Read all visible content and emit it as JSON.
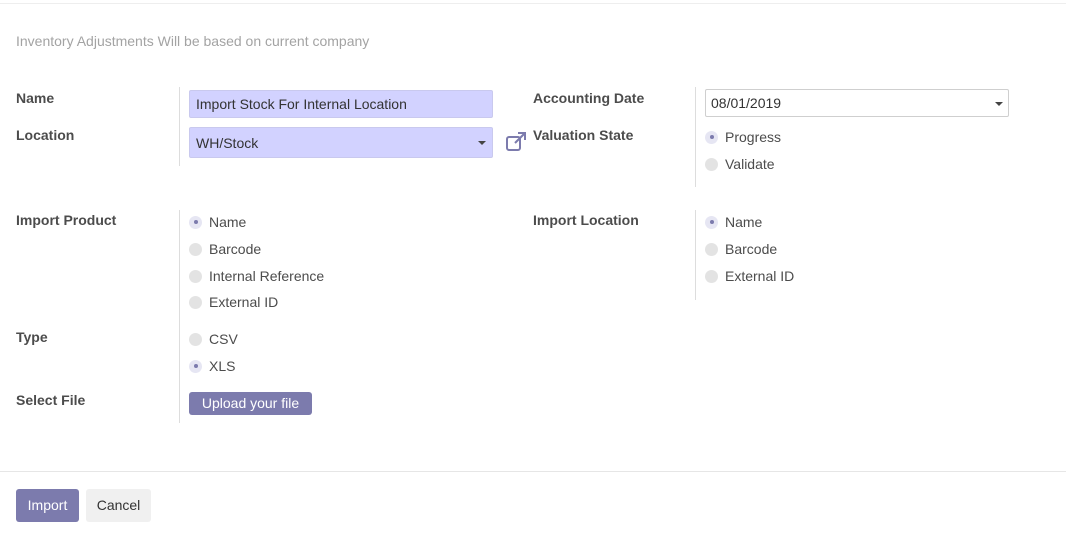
{
  "note": "Inventory Adjustments Will be based on current company",
  "fields": {
    "name": {
      "label": "Name",
      "value": "Import Stock For Internal Location"
    },
    "location": {
      "label": "Location",
      "value": "WH/Stock"
    },
    "accounting_date": {
      "label": "Accounting Date",
      "value": "08/01/2019"
    },
    "valuation_state": {
      "label": "Valuation State",
      "options": [
        "Progress",
        "Validate"
      ],
      "selected": "Progress"
    },
    "import_product": {
      "label": "Import Product",
      "options": [
        "Name",
        "Barcode",
        "Internal Reference",
        "External ID"
      ],
      "selected": "Name"
    },
    "import_location": {
      "label": "Import Location",
      "options": [
        "Name",
        "Barcode",
        "External ID"
      ],
      "selected": "Name"
    },
    "type": {
      "label": "Type",
      "options": [
        "CSV",
        "XLS"
      ],
      "selected": "XLS"
    },
    "select_file": {
      "label": "Select File",
      "button": "Upload your file"
    }
  },
  "footer": {
    "import": "Import",
    "cancel": "Cancel"
  },
  "colors": {
    "accent": "#7c7bad",
    "input_bg": "#d2d2ff"
  },
  "icons": {
    "external_link": "external-link-icon",
    "caret": "caret-down-icon"
  }
}
